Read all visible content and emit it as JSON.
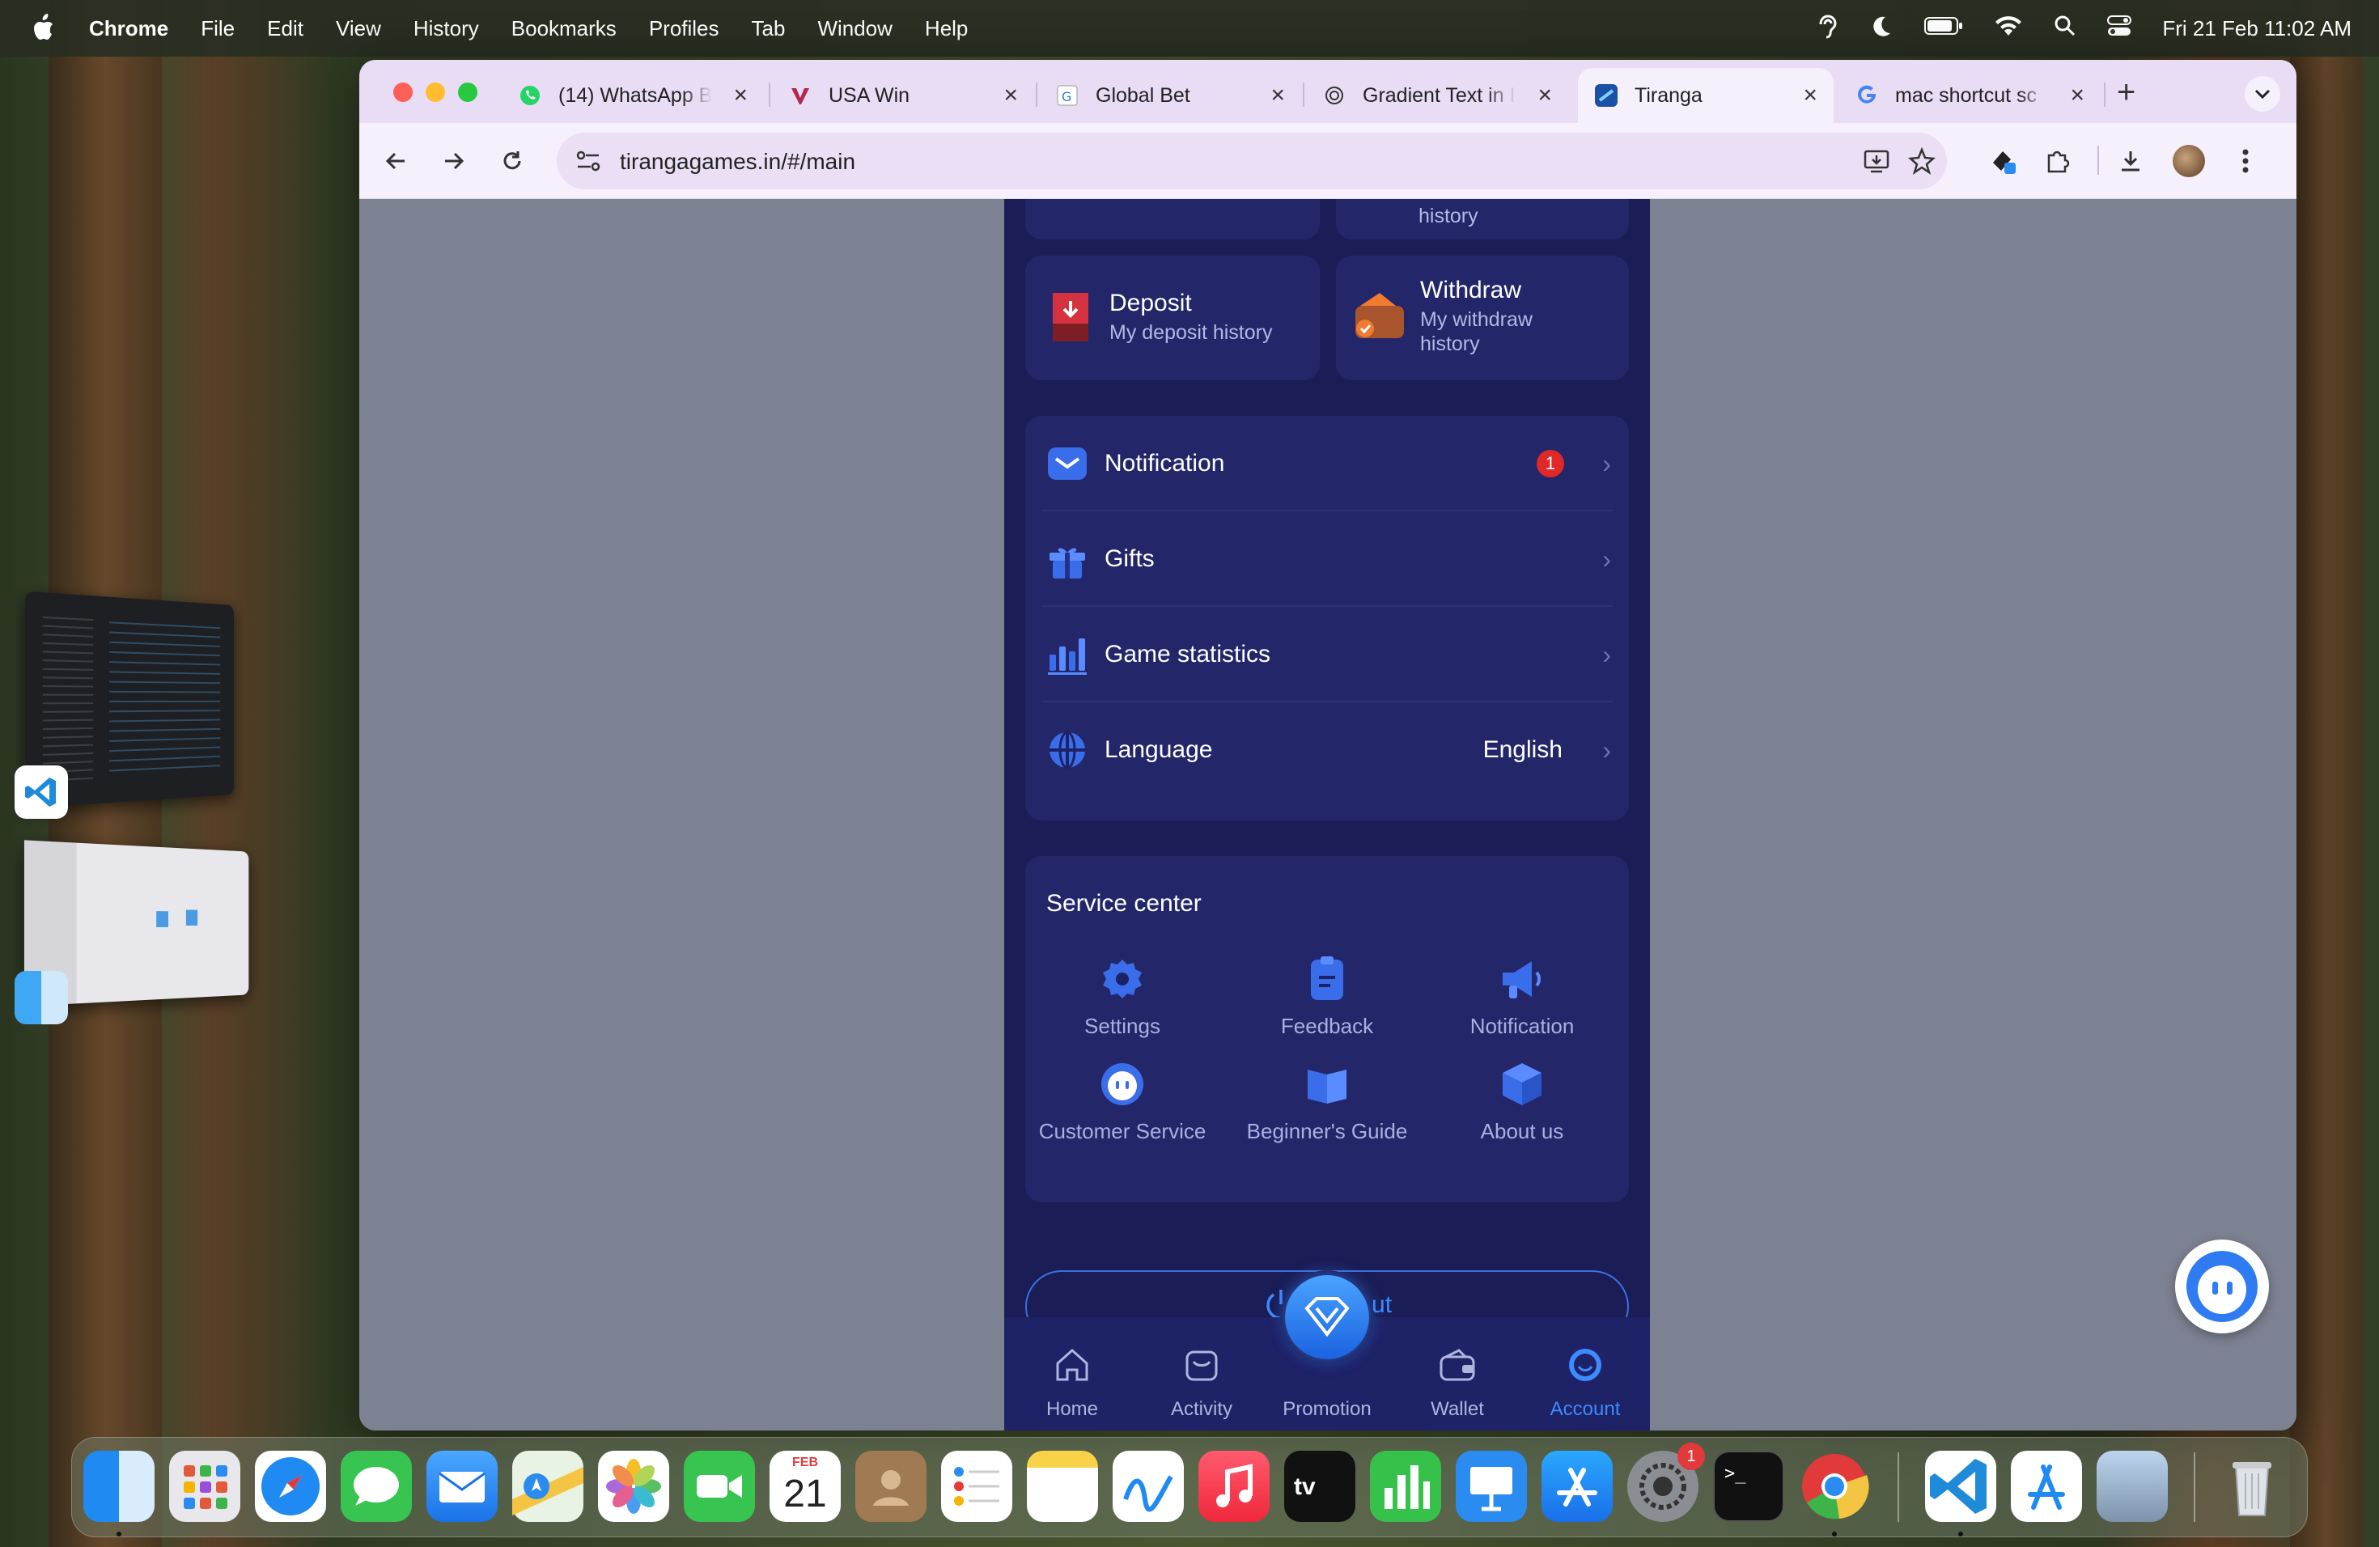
{
  "menubar": {
    "app": "Chrome",
    "items": [
      "File",
      "Edit",
      "View",
      "History",
      "Bookmarks",
      "Profiles",
      "Tab",
      "Window",
      "Help"
    ],
    "clock": "Fri 21 Feb  11:02 AM"
  },
  "tabs": [
    {
      "title": "(14) WhatsApp B",
      "icon": "whatsapp-icon"
    },
    {
      "title": "USA Win",
      "icon": "usawin-icon"
    },
    {
      "title": "Global Bet",
      "icon": "globalbet-icon"
    },
    {
      "title": "Gradient Text in I",
      "icon": "openai-icon"
    },
    {
      "title": "Tiranga",
      "icon": "tiranga-icon",
      "active": true
    },
    {
      "title": "mac shortcut sc",
      "icon": "google-icon"
    }
  ],
  "toolbar": {
    "url": "tirangagames.in/#/main"
  },
  "app": {
    "top_cut_subtitle": "history",
    "deposit": {
      "title": "Deposit",
      "subtitle": "My deposit history"
    },
    "withdraw": {
      "title": "Withdraw",
      "subtitle": "My withdraw history"
    },
    "settings_list": [
      {
        "label": "Notification",
        "badge": "1"
      },
      {
        "label": "Gifts"
      },
      {
        "label": "Game statistics"
      },
      {
        "label": "Language",
        "value": "English"
      }
    ],
    "service_center": {
      "title": "Service center",
      "items": [
        "Settings",
        "Feedback",
        "Notification",
        "Customer Service",
        "Beginner's Guide",
        "About us"
      ]
    },
    "logout_label": "Log out",
    "nav": [
      "Home",
      "Activity",
      "Promotion",
      "Wallet",
      "Account"
    ],
    "active_nav": "Account"
  },
  "dock": {
    "calendar_month": "FEB",
    "calendar_day": "21",
    "settings_badge": "1"
  },
  "colors": {
    "accent": "#3d8bff",
    "app_bg": "#1a1d56",
    "card_bg": "#23276a",
    "badge": "#e02828"
  }
}
